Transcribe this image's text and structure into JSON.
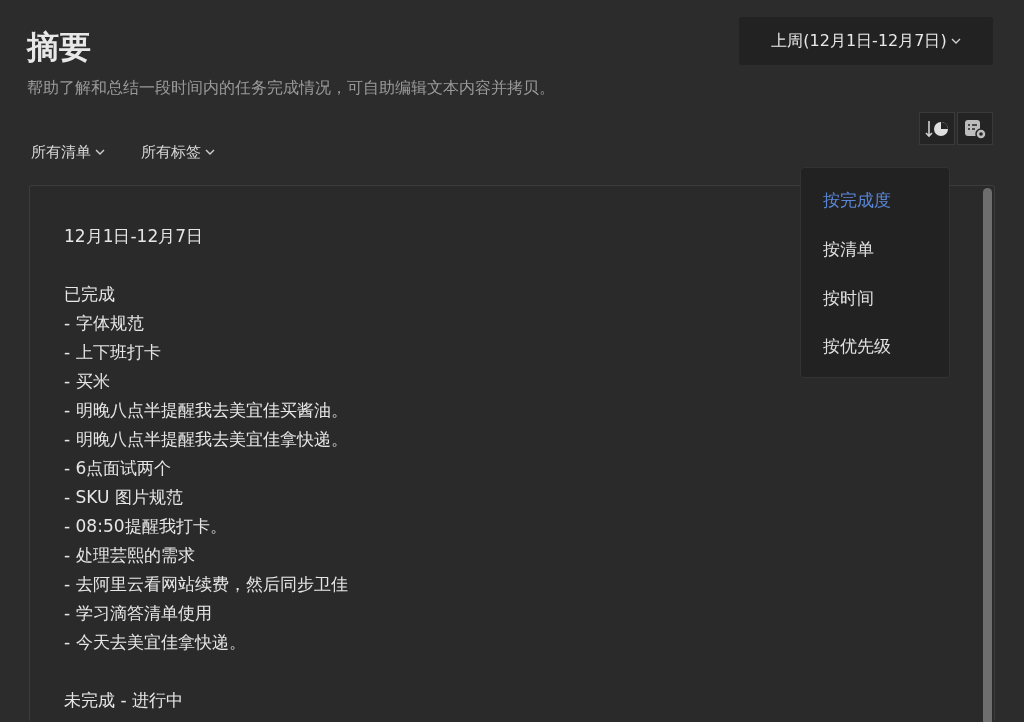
{
  "title": "摘要",
  "subtitle": "帮助了解和总结一段时间内的任务完成情况，可自助编辑文本内容并拷贝。",
  "range_button": {
    "label": "上周(12月1日-12月7日)"
  },
  "filters": [
    {
      "label": "所有清单"
    },
    {
      "label": "所有标签"
    }
  ],
  "toolbar": [
    {
      "kind": "sort"
    },
    {
      "kind": "options"
    }
  ],
  "sort_menu": [
    {
      "label": "按完成度",
      "selected": true
    },
    {
      "label": "按清单",
      "selected": false
    },
    {
      "label": "按时间",
      "selected": false
    },
    {
      "label": "按优先级",
      "selected": false
    }
  ],
  "editor": {
    "date_range": "12月1日-12月7日",
    "sections": [
      {
        "heading": "已完成",
        "items": [
          "- 字体规范",
          "- 上下班打卡",
          "- 买米",
          "- 明晚八点半提醒我去美宜佳买酱油。",
          "- 明晚八点半提醒我去美宜佳拿快递。",
          "- 6点面试两个",
          "- SKU 图片规范",
          "- 08:50提醒我打卡。",
          "- 处理芸熙的需求",
          "- 去阿里云看网站续费，然后同步卫佳",
          "- 学习滴答清单使用",
          "- 今天去美宜佳拿快递。"
        ]
      },
      {
        "heading": "未完成 - 进行中"
      }
    ]
  }
}
